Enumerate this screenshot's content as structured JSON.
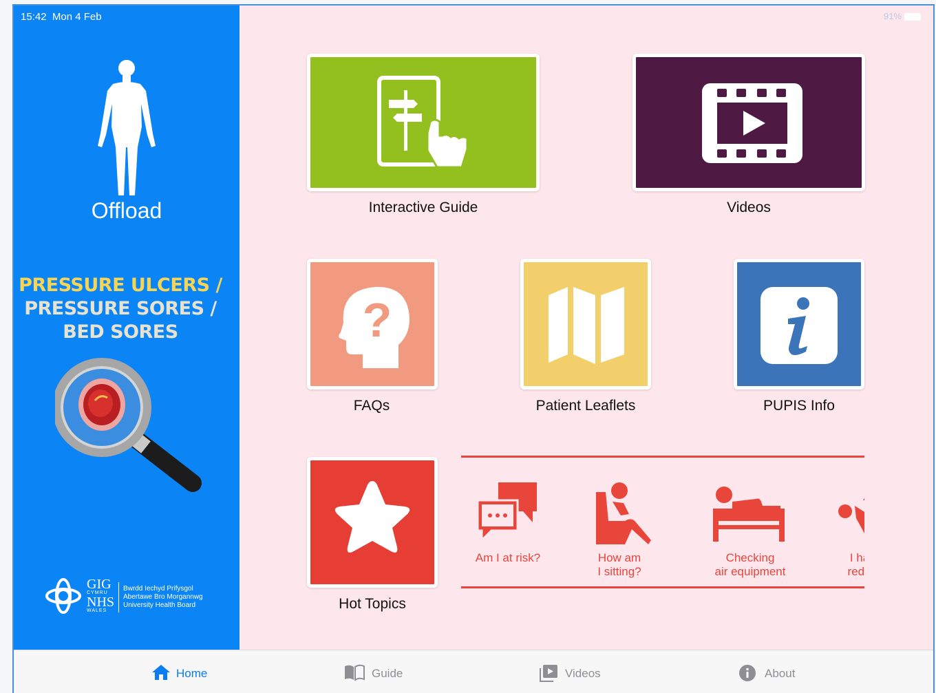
{
  "status_bar": {
    "time": "15:42",
    "date": "Mon 4 Feb",
    "battery": "91%"
  },
  "sidebar": {
    "app_name": "Offload",
    "tagline": [
      "PRESSURE ULCERS /",
      "PRESSURE SORES /",
      "BED SORES"
    ],
    "logo": {
      "text_gig": "GIG",
      "text_cymru": "CYMRU",
      "text_nhs": "NHS",
      "text_wales": "WALES",
      "board_lines": [
        "Bwrdd Iechyd Prifysgol",
        "Abertawe Bro Morgannwg",
        "University Health Board"
      ]
    }
  },
  "tiles": {
    "interactive_guide": {
      "label": "Interactive Guide",
      "color": "#93c01f",
      "icon": "signpost-touch-icon"
    },
    "videos": {
      "label": "Videos",
      "color": "#4e1942",
      "icon": "video-play-icon"
    },
    "faqs": {
      "label": "FAQs",
      "color": "#f19a80",
      "icon": "head-question-icon"
    },
    "patient_leaflets": {
      "label": "Patient Leaflets",
      "color": "#f2cf6b",
      "icon": "leaflet-map-icon"
    },
    "pupis_info": {
      "label": "PUPIS Info",
      "color": "#3c74ba",
      "icon": "info-icon"
    },
    "hot_topics": {
      "label": "Hot Topics",
      "color": "#e63e35",
      "icon": "star-icon"
    }
  },
  "hot_topics_strip": {
    "accent": "#e8453b",
    "items": [
      {
        "line1": "Am I at risk?",
        "line2": "",
        "icon": "chat-bubbles-icon"
      },
      {
        "line1": "How am",
        "line2": "I sitting?",
        "icon": "person-sitting-icon"
      },
      {
        "line1": "Checking",
        "line2": "air equipment",
        "icon": "person-lying-bed-icon"
      },
      {
        "line1": "I have",
        "line2": "red ma",
        "icon": "red-mark-warning-icon"
      }
    ]
  },
  "tab_bar": {
    "active_color": "#0b7cf2",
    "inactive_color": "#8e8e93",
    "tabs": [
      {
        "label": "Home",
        "icon": "home-icon",
        "active": true
      },
      {
        "label": "Guide",
        "icon": "book-icon",
        "active": false
      },
      {
        "label": "Videos",
        "icon": "video-icon",
        "active": false
      },
      {
        "label": "About",
        "icon": "info-icon",
        "active": false
      }
    ]
  }
}
